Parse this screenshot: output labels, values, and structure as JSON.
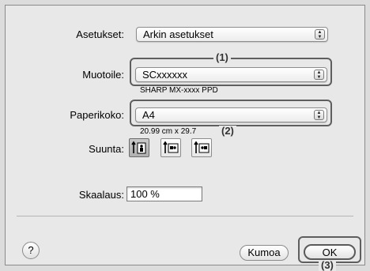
{
  "settings": {
    "label": "Asetukset:",
    "value": "Arkin asetukset"
  },
  "format": {
    "label": "Muotoile:",
    "value": "SCxxxxxx",
    "sub": "SHARP MX-xxxx PPD"
  },
  "paper": {
    "label": "Paperikoko:",
    "value": "A4",
    "sub": "20.99 cm x 29.7"
  },
  "orientation": {
    "label": "Suunta:",
    "selected": "portrait"
  },
  "scale": {
    "label": "Skaalaus:",
    "value": "100 %"
  },
  "buttons": {
    "help": "?",
    "cancel": "Kumoa",
    "ok": "OK"
  },
  "callouts": {
    "c1": "(1)",
    "c2": "(2)",
    "c3": "(3)"
  },
  "icons": {
    "popup_arrows": "up-down-arrows-icon"
  }
}
